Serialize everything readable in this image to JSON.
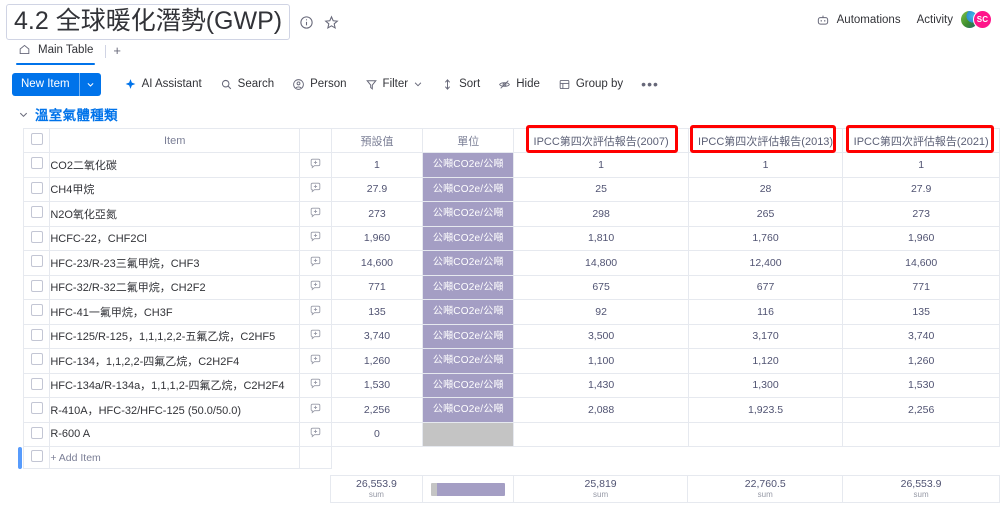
{
  "header": {
    "board_title": "4.2 全球暖化潛勢(GWP)",
    "info_icon": "info-circle-icon",
    "favorite_icon": "star-icon",
    "automations_label": "Automations",
    "activity_label": "Activity",
    "avatar_initials": "SC"
  },
  "tabs": {
    "main_tab_label": "Main Table",
    "add_tab_label": "+"
  },
  "toolbar": {
    "new_item_label": "New Item",
    "ai_assistant_label": "AI Assistant",
    "search_label": "Search",
    "person_label": "Person",
    "filter_label": "Filter",
    "sort_label": "Sort",
    "hide_label": "Hide",
    "group_by_label": "Group by",
    "more_label": "•••"
  },
  "group": {
    "title": "溫室氣體種類",
    "color": "#579bfc"
  },
  "table": {
    "columns": [
      "Item",
      "預設值",
      "單位",
      "IPCC第四次評估報告(2007)",
      "IPCC第四次評估報告(2013)",
      "IPCC第四次評估報告(2021)"
    ],
    "unit_badge_color": "#a49ec4",
    "rows": [
      {
        "item": "CO2二氧化碳",
        "default": "1",
        "unit": "公噸CO2e/公噸",
        "v2007": "1",
        "v2013": "1",
        "v2021": "1"
      },
      {
        "item": "CH4甲烷",
        "default": "27.9",
        "unit": "公噸CO2e/公噸",
        "v2007": "25",
        "v2013": "28",
        "v2021": "27.9"
      },
      {
        "item": "N2O氧化亞氮",
        "default": "273",
        "unit": "公噸CO2e/公噸",
        "v2007": "298",
        "v2013": "265",
        "v2021": "273"
      },
      {
        "item": "HCFC-22，CHF2Cl",
        "default": "1,960",
        "unit": "公噸CO2e/公噸",
        "v2007": "1,810",
        "v2013": "1,760",
        "v2021": "1,960"
      },
      {
        "item": "HFC-23/R-23三氟甲烷，CHF3",
        "default": "14,600",
        "unit": "公噸CO2e/公噸",
        "v2007": "14,800",
        "v2013": "12,400",
        "v2021": "14,600"
      },
      {
        "item": "HFC-32/R-32二氟甲烷，CH2F2",
        "default": "771",
        "unit": "公噸CO2e/公噸",
        "v2007": "675",
        "v2013": "677",
        "v2021": "771"
      },
      {
        "item": "HFC-41一氟甲烷，CH3F",
        "default": "135",
        "unit": "公噸CO2e/公噸",
        "v2007": "92",
        "v2013": "116",
        "v2021": "135"
      },
      {
        "item": "HFC-125/R-125，1,1,1,2,2-五氟乙烷，C2HF5",
        "default": "3,740",
        "unit": "公噸CO2e/公噸",
        "v2007": "3,500",
        "v2013": "3,170",
        "v2021": "3,740"
      },
      {
        "item": "HFC-134，1,1,2,2-四氟乙烷，C2H2F4",
        "default": "1,260",
        "unit": "公噸CO2e/公噸",
        "v2007": "1,100",
        "v2013": "1,120",
        "v2021": "1,260"
      },
      {
        "item": "HFC-134a/R-134a，1,1,1,2-四氟乙烷，C2H2F4",
        "default": "1,530",
        "unit": "公噸CO2e/公噸",
        "v2007": "1,430",
        "v2013": "1,300",
        "v2021": "1,530"
      },
      {
        "item": "R-410A，HFC-32/HFC-125 (50.0/50.0)",
        "default": "2,256",
        "unit": "公噸CO2e/公噸",
        "v2007": "2,088",
        "v2013": "1,923.5",
        "v2021": "2,256"
      },
      {
        "item": "R-600 A",
        "default": "0",
        "unit": "",
        "v2007": "",
        "v2013": "",
        "v2021": ""
      }
    ],
    "add_item_label": "+ Add Item",
    "summary": {
      "default_value": "26,553.9",
      "default_label": "sum",
      "v2007_value": "25,819",
      "v2007_label": "sum",
      "v2013_value": "22,760.5",
      "v2013_label": "sum",
      "v2021_value": "26,553.9",
      "v2021_label": "sum"
    }
  },
  "annotations": {
    "color": "#ff0000",
    "boxes": [
      "IPCC第四次評估報告(2007)",
      "IPCC第四次評估報告(2013)",
      "IPCC第四次評估報告(2021)"
    ]
  }
}
